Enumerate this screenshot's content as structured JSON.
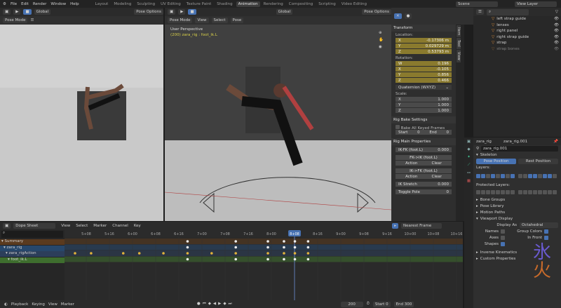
{
  "menu": [
    "File",
    "Edit",
    "Render",
    "Window",
    "Help"
  ],
  "workspaces": [
    {
      "label": "Layout"
    },
    {
      "label": "Modeling"
    },
    {
      "label": "Sculpting"
    },
    {
      "label": "UV Editing"
    },
    {
      "label": "Texture Paint"
    },
    {
      "label": "Shading"
    },
    {
      "label": "Animation",
      "active": true
    },
    {
      "label": "Rendering"
    },
    {
      "label": "Compositing"
    },
    {
      "label": "Scripting"
    },
    {
      "label": "Video Editing"
    }
  ],
  "scene": "Scene",
  "view_layer": "View Layer",
  "header": {
    "transform_orientation": "Global",
    "pose_options": "Pose Options",
    "mode": "Pose Mode",
    "view": "View",
    "select": "Select",
    "pose": "Pose"
  },
  "viewport": {
    "perspective": "User Perspective",
    "object_info": "(200) zara_rig : foot_ik.L"
  },
  "npanel": {
    "transform": "Transform",
    "location_label": "Location:",
    "location": [
      {
        "axis": "X",
        "value": "-0.17306 m"
      },
      {
        "axis": "Y",
        "value": "0.029729 m"
      },
      {
        "axis": "Z",
        "value": "0.53793 m"
      }
    ],
    "rotation_label": "Rotation:",
    "rotation": [
      {
        "axis": "W",
        "value": "0.196"
      },
      {
        "axis": "X",
        "value": "-0.105"
      },
      {
        "axis": "Y",
        "value": "0.856"
      },
      {
        "axis": "Z",
        "value": "0.466"
      }
    ],
    "rotation_mode": "Quaternion (WXYZ)",
    "scale_label": "Scale:",
    "scale": [
      {
        "axis": "X",
        "value": "1.000"
      },
      {
        "axis": "Y",
        "value": "1.000"
      },
      {
        "axis": "Z",
        "value": "1.000"
      }
    ],
    "rig_bake": "Rig Bake Settings",
    "bake_all": "Bake All Keyed Frames",
    "start": "Start",
    "start_val": "0",
    "end": "End",
    "end_val": "0",
    "rig_main": "Rig Main Properties",
    "ikfk": "IK-FK (foot.L)",
    "ikfk_val": "0.000",
    "fk_to_ik": "FK->IK (foot.L)",
    "ik_to_fk": "IK->FK (foot.L)",
    "action": "Action",
    "clear": "Clear",
    "ik_stretch": "IK Stretch",
    "ik_stretch_val": "0.000",
    "toggle_pole": "Toggle Pole",
    "toggle_pole_val": "0"
  },
  "side_tabs": [
    "Item",
    "Tool",
    "View"
  ],
  "outliner": [
    {
      "name": "left strap guide"
    },
    {
      "name": "lenses"
    },
    {
      "name": "right panel"
    },
    {
      "name": "right strap guide"
    },
    {
      "name": "strap"
    },
    {
      "name": "strap bones"
    }
  ],
  "properties": {
    "object": "zara_rig",
    "data": "zara_rig.001",
    "data_field": "zara_rig.001",
    "skeleton": "Skeleton",
    "pose_position": "Pose Position",
    "rest_position": "Rest Position",
    "layers": "Layers:",
    "protected_layers": "Protected Layers:",
    "panels": [
      "Bone Groups",
      "Pose Library",
      "Motion Paths"
    ],
    "viewport_display": "Viewport Display",
    "display_as": "Display As",
    "display_as_val": "Octahedral",
    "names": "Names",
    "names_on": false,
    "axes": "Axes",
    "axes_on": false,
    "shapes": "Shapes",
    "shapes_on": true,
    "group_colors": "Group Colors",
    "group_colors_on": true,
    "in_front": "In Front",
    "in_front_on": true,
    "panels2": [
      "Inverse Kinematics",
      "Custom Properties"
    ]
  },
  "dopesheet": {
    "mode": "Dope Sheet",
    "menus": [
      "View",
      "Select",
      "Marker",
      "Channel",
      "Key"
    ],
    "snap": "Nearest Frame",
    "channels": [
      {
        "name": "Summary",
        "color": "#5a3a1e"
      },
      {
        "name": "zara_rig",
        "color": "#27476b"
      },
      {
        "name": "zara_rigAction",
        "color": "#2c3e5a"
      },
      {
        "name": "foot_ik.L",
        "color": "#3e6e2e"
      }
    ],
    "ticks": [
      "5+08",
      "5+16",
      "6+00",
      "6+08",
      "6+16",
      "7+00",
      "7+08",
      "7+16",
      "8+00",
      "8+08",
      "8+16",
      "9+00",
      "9+08",
      "9+16",
      "10+00",
      "10+08",
      "10+16"
    ],
    "current_frame": "8+08",
    "keys_white": [
      6.75,
      7.5,
      8.0,
      8.25,
      8.42,
      8.625
    ],
    "keys_orange": [
      5.0,
      5.25,
      5.75,
      6.0,
      6.375,
      6.75,
      7.125,
      7.5,
      8.0,
      8.25,
      8.42,
      8.625
    ]
  },
  "timeline": {
    "playback": "Playback",
    "keying": "Keying",
    "view": "View",
    "marker": "Marker",
    "frame": "200",
    "start": "Start",
    "start_val": "0",
    "end": "End",
    "end_val": "300"
  },
  "colors": {
    "accent": "#4772b3",
    "keyframe": "#e2b33c",
    "field_yellow": "#8a7a2e"
  }
}
